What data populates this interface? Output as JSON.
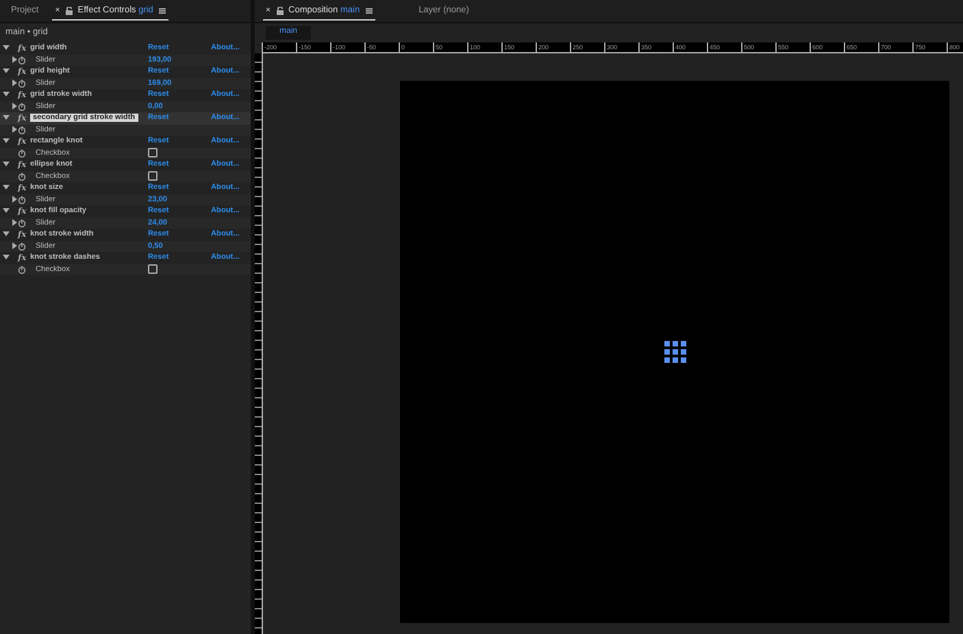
{
  "left_panel": {
    "tabs": [
      {
        "label": "Project",
        "selected": false
      },
      {
        "label": "Effect Controls",
        "target": "grid",
        "selected": true,
        "close": "×"
      }
    ],
    "breadcrumb": "main • grid"
  },
  "effects": [
    {
      "icon": "fx",
      "name": "grid width",
      "selected": false,
      "expanded": true,
      "reset": "Reset",
      "about": "About...",
      "param": {
        "kind": "slider",
        "label": "Slider",
        "value": "193,00"
      }
    },
    {
      "icon": "fx",
      "name": "grid height",
      "selected": false,
      "expanded": true,
      "reset": "Reset",
      "about": "About...",
      "param": {
        "kind": "slider",
        "label": "Slider",
        "value": "169,00"
      }
    },
    {
      "icon": "fx",
      "name": "grid stroke width",
      "selected": false,
      "expanded": true,
      "reset": "Reset",
      "about": "About...",
      "param": {
        "kind": "slider",
        "label": "Slider",
        "value": "0,00"
      }
    },
    {
      "icon": "fx",
      "name": "secondary grid stroke width",
      "selected": true,
      "expanded": true,
      "reset": "Reset",
      "about": "About...",
      "param": {
        "kind": "slider",
        "label": "Slider"
      }
    },
    {
      "icon": "fx",
      "name": "rectangle knot",
      "selected": false,
      "expanded": true,
      "reset": "Reset",
      "about": "About...",
      "param": {
        "kind": "checkbox",
        "label": "Checkbox",
        "checked": false
      }
    },
    {
      "icon": "fx",
      "name": "ellipse knot",
      "selected": false,
      "expanded": true,
      "reset": "Reset",
      "about": "About...",
      "param": {
        "kind": "checkbox",
        "label": "Checkbox",
        "checked": false
      }
    },
    {
      "icon": "fx",
      "name": "knot size",
      "selected": false,
      "expanded": true,
      "reset": "Reset",
      "about": "About...",
      "param": {
        "kind": "slider",
        "label": "Slider",
        "value": "23,00"
      }
    },
    {
      "icon": "fx",
      "name": "knot fill opacity",
      "selected": false,
      "expanded": true,
      "reset": "Reset",
      "about": "About...",
      "param": {
        "kind": "slider",
        "label": "Slider",
        "value": "24,00"
      }
    },
    {
      "icon": "fx",
      "name": "knot stroke width",
      "selected": false,
      "expanded": true,
      "reset": "Reset",
      "about": "About...",
      "param": {
        "kind": "slider",
        "label": "Slider",
        "value": "0,50"
      }
    },
    {
      "icon": "fx",
      "name": "knot stroke dashes",
      "selected": false,
      "expanded": true,
      "reset": "Reset",
      "about": "About...",
      "param": {
        "kind": "checkbox",
        "label": "Checkbox",
        "checked": false
      }
    }
  ],
  "right_panel": {
    "tabs": [
      {
        "label": "Composition",
        "target": "main",
        "selected": true,
        "close": "×"
      },
      {
        "label": "Layer (none)",
        "selected": false
      }
    ],
    "subtab": "main",
    "ruler": [
      "-200",
      "-150",
      "-100",
      "-50",
      "0",
      "50",
      "100",
      "150",
      "200",
      "250",
      "300",
      "350",
      "400",
      "450",
      "500",
      "550",
      "600",
      "650",
      "700",
      "750",
      "800"
    ]
  }
}
